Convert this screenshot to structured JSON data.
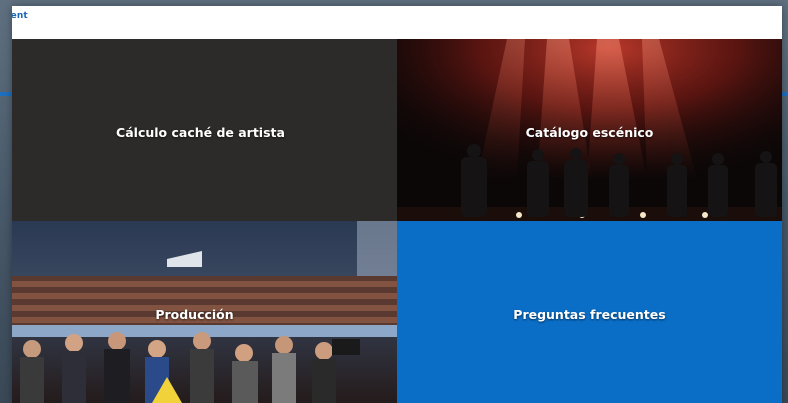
{
  "brand": {
    "text": "lment",
    "color": "#1f66b3"
  },
  "tiles": [
    {
      "title": "Cálculo caché de artista",
      "bg": "#2c2b29"
    },
    {
      "title": "Catálogo escénico",
      "bg": "#0c0707"
    },
    {
      "title": "Producción",
      "bg": "#1a2433"
    },
    {
      "title": "Preguntas frecuentes",
      "bg": "#0b6ec6"
    }
  ]
}
